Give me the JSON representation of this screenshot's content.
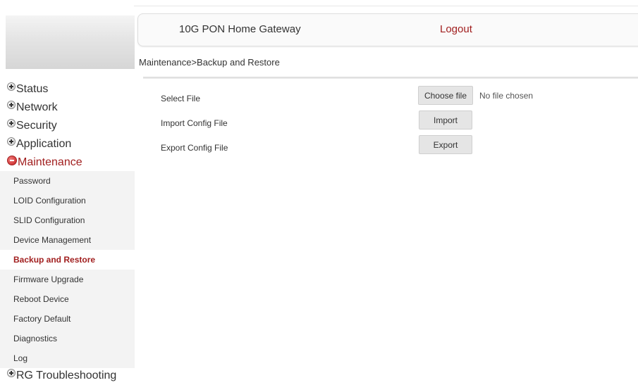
{
  "header": {
    "title": "10G PON Home Gateway",
    "logout_label": "Logout"
  },
  "breadcrumb": "Maintenance>Backup and Restore",
  "sidebar": {
    "main_items": [
      {
        "label": "Status",
        "icon": "plus-circle-icon",
        "active": false
      },
      {
        "label": "Network",
        "icon": "plus-circle-icon",
        "active": false
      },
      {
        "label": "Security",
        "icon": "plus-circle-icon",
        "active": false
      },
      {
        "label": "Application",
        "icon": "plus-circle-icon",
        "active": false
      },
      {
        "label": "Maintenance",
        "icon": "minus-circle-icon",
        "active": true
      }
    ],
    "sub_items": [
      {
        "label": "Password",
        "selected": false
      },
      {
        "label": "LOID Configuration",
        "selected": false
      },
      {
        "label": "SLID Configuration",
        "selected": false
      },
      {
        "label": "Device Management",
        "selected": false
      },
      {
        "label": "Backup and Restore",
        "selected": true
      },
      {
        "label": "Firmware Upgrade",
        "selected": false
      },
      {
        "label": "Reboot Device",
        "selected": false
      },
      {
        "label": "Factory Default",
        "selected": false
      },
      {
        "label": "Diagnostics",
        "selected": false
      },
      {
        "label": "Log",
        "selected": false
      }
    ],
    "last_item": {
      "label": "RG Troubleshooting",
      "icon": "plus-circle-icon",
      "active": false
    }
  },
  "form": {
    "select_file_label": "Select File",
    "choose_file_label": "Choose file",
    "no_file_text": "No file chosen",
    "import_config_label": "Import Config File",
    "import_button": "Import",
    "export_config_label": "Export Config File",
    "export_button": "Export"
  },
  "colors": {
    "accent": "#a11f1f",
    "sidebar_bg": "#f3f3f3",
    "button_bg": "#e5e5e5"
  }
}
